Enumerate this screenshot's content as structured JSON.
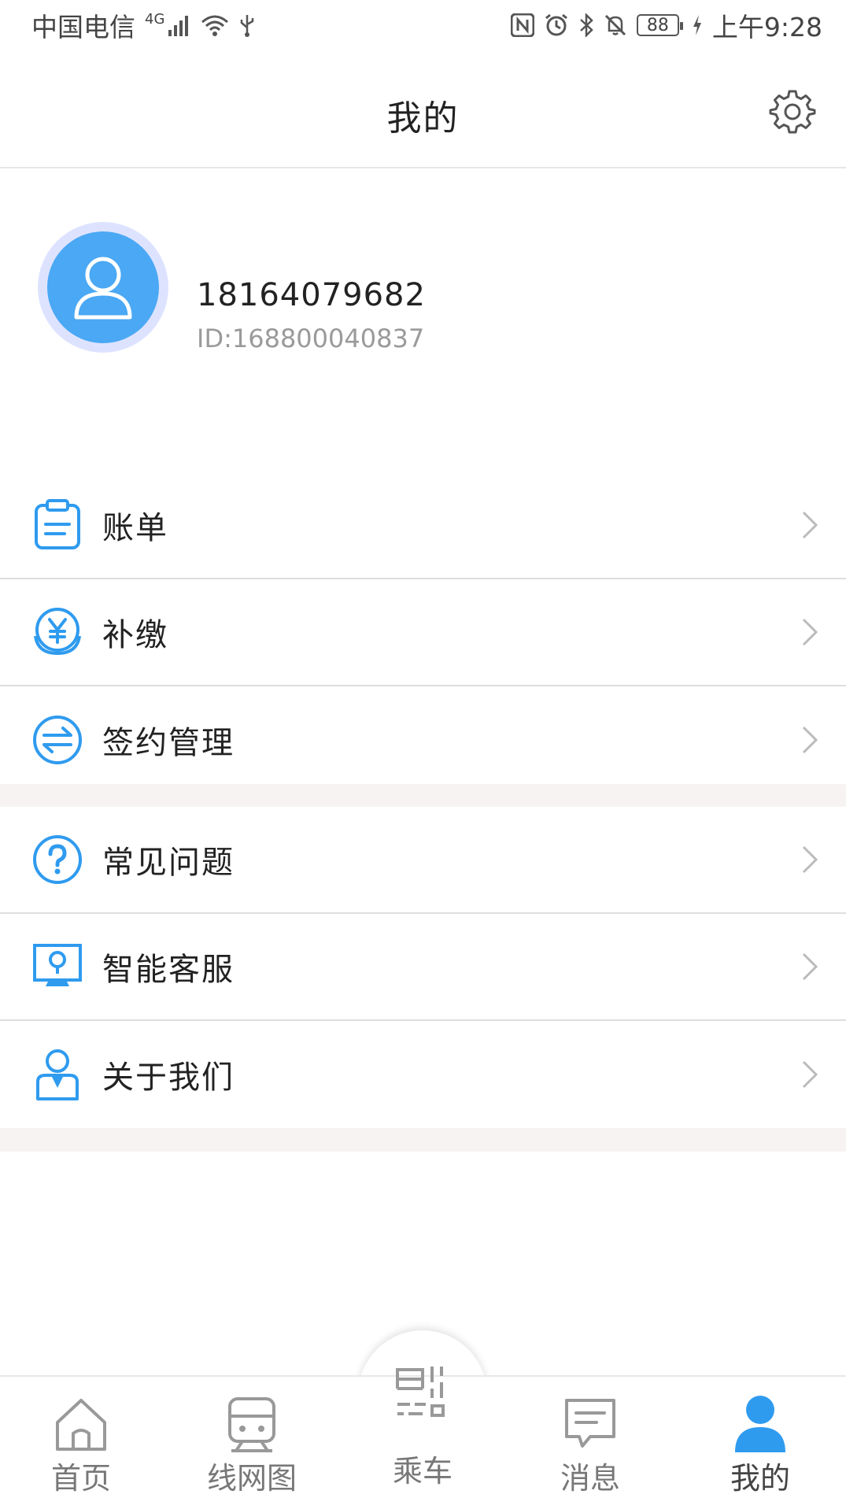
{
  "status_bar": {
    "carrier": "中国电信",
    "network": "4G",
    "battery": "88",
    "time": "上午9:28"
  },
  "header": {
    "title": "我的"
  },
  "profile": {
    "phone": "18164079682",
    "user_id": "ID:168800040837"
  },
  "menu_group_1": [
    {
      "label": "账单",
      "icon": "bill-icon"
    },
    {
      "label": "补缴",
      "icon": "yuan-coin-icon"
    },
    {
      "label": "签约管理",
      "icon": "exchange-icon"
    }
  ],
  "menu_group_2": [
    {
      "label": "常见问题",
      "icon": "question-icon"
    },
    {
      "label": "智能客服",
      "icon": "customer-service-icon"
    },
    {
      "label": "关于我们",
      "icon": "about-user-icon"
    }
  ],
  "bottom_nav": {
    "home": "首页",
    "line_map": "线网图",
    "ride": "乘车",
    "messages": "消息",
    "mine": "我的"
  },
  "colors": {
    "accent": "#2f9bef",
    "avatar_ring": "#dde3ff",
    "avatar_fill": "#4aa8f4",
    "band": "#f7f3f3"
  }
}
